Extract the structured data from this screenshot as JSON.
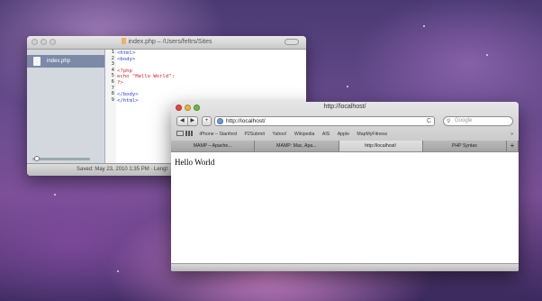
{
  "editor": {
    "title": "index.php – /Users/feltrs/Sites",
    "sidebar_file": "index.php",
    "lines": [
      {
        "num": "1",
        "parts": [
          {
            "t": "<html>",
            "c": "tag"
          }
        ]
      },
      {
        "num": "2",
        "parts": [
          {
            "t": "<body>",
            "c": "tag"
          }
        ]
      },
      {
        "num": "3",
        "parts": []
      },
      {
        "num": "4",
        "parts": [
          {
            "t": "<?php",
            "c": "php"
          }
        ]
      },
      {
        "num": "5",
        "parts": [
          {
            "t": "echo ",
            "c": "php"
          },
          {
            "t": "\"Hello World\"",
            "c": "str"
          },
          {
            "t": ";",
            "c": "php"
          }
        ]
      },
      {
        "num": "6",
        "parts": [
          {
            "t": "?>",
            "c": "php"
          }
        ]
      },
      {
        "num": "7",
        "parts": []
      },
      {
        "num": "8",
        "parts": [
          {
            "t": "</body>",
            "c": "tag"
          }
        ]
      },
      {
        "num": "9",
        "parts": [
          {
            "t": "</html>",
            "c": "tag"
          }
        ]
      }
    ],
    "status": "Saved: May 23, 2010 1:35 PM  ·  Lengt"
  },
  "browser": {
    "title": "http://localhost/",
    "back": "◀",
    "forward": "▶",
    "add": "+",
    "address": "http://localhost/",
    "reload": "C",
    "search_placeholder": "Google",
    "bookmarks": [
      "iPhone – Stanford",
      "P2Submit",
      "Yahoo!",
      "Wikipedia",
      "AIS",
      "Apple",
      "MapMyFitness"
    ],
    "bookmarks_more": "»",
    "tabs": [
      "MAMP – Apache...",
      "MAMP: Mac, Apa...",
      "http://localhost/",
      "PHP Syntax"
    ],
    "active_tab": 2,
    "new_tab": "+",
    "page_text": "Hello World"
  },
  "colors": {
    "tag": "#2a3bd0",
    "string": "#d02020",
    "php": "#c03030"
  }
}
